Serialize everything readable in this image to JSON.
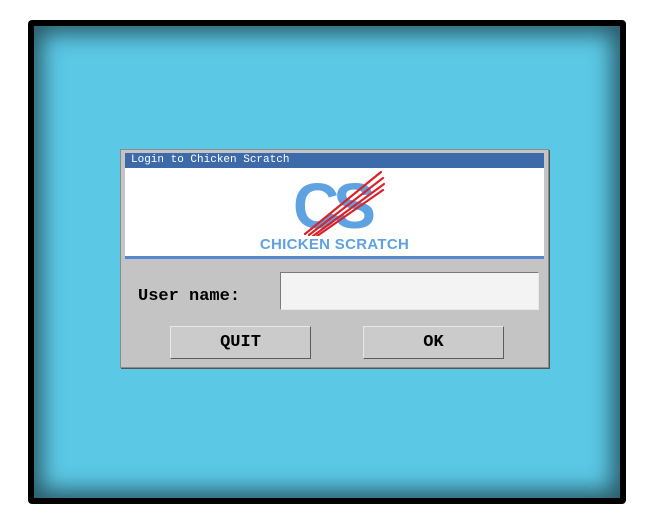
{
  "dialog": {
    "title": "Login to Chicken Scratch",
    "logo_mark": "CS",
    "logo_caption": "CHICKEN SCRATCH",
    "username_label": "User name:",
    "username_value": "",
    "quit_label": "QUIT",
    "ok_label": "OK"
  },
  "colors": {
    "screen_background": "#5bc8e6",
    "titlebar": "#3d6aa8",
    "logo_blue": "#5ea2e2",
    "logo_scratch_red": "#d8232a",
    "dialog_gray": "#c4c4c4"
  },
  "icons": [
    "chicken-scratch-logo-icon"
  ]
}
